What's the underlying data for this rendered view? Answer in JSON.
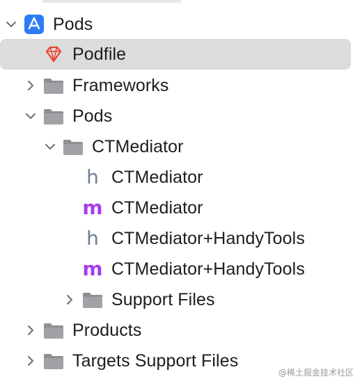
{
  "tree": {
    "project": {
      "label": "Pods"
    },
    "podfile": {
      "label": "Podfile"
    },
    "frameworks": {
      "label": "Frameworks"
    },
    "pods_group": {
      "label": "Pods"
    },
    "ctmediator_group": {
      "label": "CTMediator"
    },
    "file_h1": {
      "label": "CTMediator",
      "glyph": "h"
    },
    "file_m1": {
      "label": "CTMediator",
      "glyph": "m"
    },
    "file_h2": {
      "label": "CTMediator+HandyTools",
      "glyph": "h"
    },
    "file_m2": {
      "label": "CTMediator+HandyTools",
      "glyph": "m"
    },
    "support_files": {
      "label": "Support Files"
    },
    "products": {
      "label": "Products"
    },
    "targets_support": {
      "label": "Targets Support Files"
    }
  },
  "watermark": "@稀土掘金技术社区",
  "colors": {
    "folder": "#8e8e93",
    "app_icon": "#2d7cf6",
    "ruby": "#e8452c",
    "selection": "#dcdcdc"
  }
}
